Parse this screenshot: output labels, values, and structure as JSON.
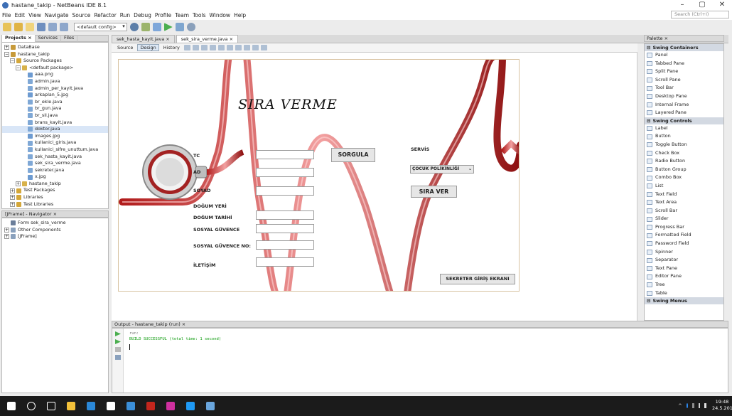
{
  "window": {
    "title": "hastane_takip - NetBeans IDE 8.1",
    "controls": [
      "–",
      "▢",
      "✕"
    ]
  },
  "menu": [
    "File",
    "Edit",
    "View",
    "Navigate",
    "Source",
    "Refactor",
    "Run",
    "Debug",
    "Profile",
    "Team",
    "Tools",
    "Window",
    "Help"
  ],
  "search": {
    "placeholder": "Search (Ctrl+I)"
  },
  "toolbar": {
    "config": "<default config>"
  },
  "projects_panel": {
    "tabs": [
      "Projects ×",
      "Services",
      "Files"
    ],
    "tree": [
      {
        "label": "DataBase",
        "level": 0,
        "exp": "+",
        "icon": "#c79a3a"
      },
      {
        "label": "hastane_takip",
        "level": 0,
        "exp": "−",
        "icon": "#c79a3a"
      },
      {
        "label": "Source Packages",
        "level": 1,
        "exp": "−",
        "icon": "#d4a73a"
      },
      {
        "label": "<default package>",
        "level": 2,
        "exp": "−",
        "icon": "#d8b24a"
      },
      {
        "label": "aaa.png",
        "level": 3,
        "icon": "#6d9bd1"
      },
      {
        "label": "admin.java",
        "level": 3,
        "icon": "#7fa8d6"
      },
      {
        "label": "admin_per_kayit.java",
        "level": 3,
        "icon": "#7fa8d6"
      },
      {
        "label": "arkaplan_5.jpg",
        "level": 3,
        "icon": "#6d9bd1"
      },
      {
        "label": "br_ekle.java",
        "level": 3,
        "icon": "#7fa8d6"
      },
      {
        "label": "br_gun.java",
        "level": 3,
        "icon": "#7fa8d6"
      },
      {
        "label": "br_sil.java",
        "level": 3,
        "icon": "#7fa8d6"
      },
      {
        "label": "brans_kayit.java",
        "level": 3,
        "icon": "#7fa8d6"
      },
      {
        "label": "doktor.java",
        "level": 3,
        "icon": "#7fa8d6",
        "selected": true
      },
      {
        "label": "images.jpg",
        "level": 3,
        "icon": "#6d9bd1"
      },
      {
        "label": "kullanici_giris.java",
        "level": 3,
        "icon": "#7fa8d6"
      },
      {
        "label": "kullanici_sifre_unuttum.java",
        "level": 3,
        "icon": "#7fa8d6"
      },
      {
        "label": "sek_hasta_kayit.java",
        "level": 3,
        "icon": "#7fa8d6"
      },
      {
        "label": "sek_sira_verme.java",
        "level": 3,
        "icon": "#7fa8d6"
      },
      {
        "label": "sekreter.java",
        "level": 3,
        "icon": "#7fa8d6"
      },
      {
        "label": "x.jpg",
        "level": 3,
        "icon": "#6d9bd1"
      },
      {
        "label": "hastane_takip",
        "level": 2,
        "exp": "+",
        "icon": "#d8b24a"
      },
      {
        "label": "Test Packages",
        "level": 1,
        "exp": "+",
        "icon": "#d4a73a"
      },
      {
        "label": "Libraries",
        "level": 1,
        "exp": "+",
        "icon": "#d4a73a"
      },
      {
        "label": "Test Libraries",
        "level": 1,
        "exp": "+",
        "icon": "#d4a73a"
      }
    ]
  },
  "navigator_panel": {
    "title": "[JFrame] - Navigator ×",
    "tree": [
      {
        "label": "Form sek_sira_verme",
        "level": 0,
        "icon": "#6b7e9a"
      },
      {
        "label": "Other Components",
        "level": 0,
        "exp": "+",
        "icon": "#8aa1bd"
      },
      {
        "label": "[JFrame]",
        "level": 0,
        "exp": "+",
        "icon": "#8aa1bd"
      }
    ]
  },
  "editor": {
    "tabs": [
      {
        "label": "sek_hasta_kayit.java ×",
        "active": false
      },
      {
        "label": "sek_sira_verme.java ×",
        "active": true
      }
    ],
    "views": [
      "Source",
      "Design",
      "History"
    ],
    "active_view": "Design"
  },
  "form": {
    "title": "SIRA VERME",
    "labels": [
      "TC",
      "AD",
      "SOYAD",
      "DOĞUM YERİ",
      "DOĞUM TARİHİ",
      "SOSYAL GÜVENCE",
      "SOSYAL GÜVENCE NO:",
      "İLETİŞİM"
    ],
    "sorgula": "SORGULA",
    "servis_label": "SERVİS",
    "servis_value": "ÇOCUK POLİKİNLİĞİ",
    "sira_ver": "SIRA VER",
    "sekreter_btn": "SEKRETER GİRİŞ EKRANI"
  },
  "palette": {
    "title": "Palette ×",
    "groups": [
      {
        "name": "Swing Containers",
        "items": [
          "Panel",
          "Tabbed Pane",
          "Split Pane",
          "Scroll Pane",
          "Tool Bar",
          "Desktop Pane",
          "Internal Frame",
          "Layered Pane"
        ]
      },
      {
        "name": "Swing Controls",
        "items": [
          "Label",
          "Button",
          "Toggle Button",
          "Check Box",
          "Radio Button",
          "Button Group",
          "Combo Box",
          "List",
          "Text Field",
          "Text Area",
          "Scroll Bar",
          "Slider",
          "Progress Bar",
          "Formatted Field",
          "Password Field",
          "Spinner",
          "Separator",
          "Text Pane",
          "Editor Pane",
          "Tree",
          "Table"
        ]
      },
      {
        "name": "Swing Menus",
        "items": []
      }
    ]
  },
  "output": {
    "title": "Output - hastane_takip (run) ×",
    "lines": [
      "run:",
      "BUILD SUCCESSFUL (total time: 1 second)"
    ]
  },
  "taskbar": {
    "icons": [
      {
        "name": "start-icon",
        "color": "#ffffff"
      },
      {
        "name": "search-icon",
        "color": "#ffffff"
      },
      {
        "name": "task-view-icon",
        "color": "#ffffff"
      },
      {
        "name": "file-explorer-icon",
        "color": "#f3c13a"
      },
      {
        "name": "edge-icon",
        "color": "#2b88d8"
      },
      {
        "name": "store-icon",
        "color": "#ffffff"
      },
      {
        "name": "app-icon",
        "color": "#3b8fd9"
      },
      {
        "name": "flash-icon",
        "color": "#c4261d"
      },
      {
        "name": "pink-app-icon",
        "color": "#d0309f"
      },
      {
        "name": "photoshop-icon",
        "color": "#1f9af5"
      },
      {
        "name": "netbeans-icon",
        "color": "#6aa6dd"
      }
    ],
    "time": "19:48",
    "date": "24.5.2016"
  }
}
